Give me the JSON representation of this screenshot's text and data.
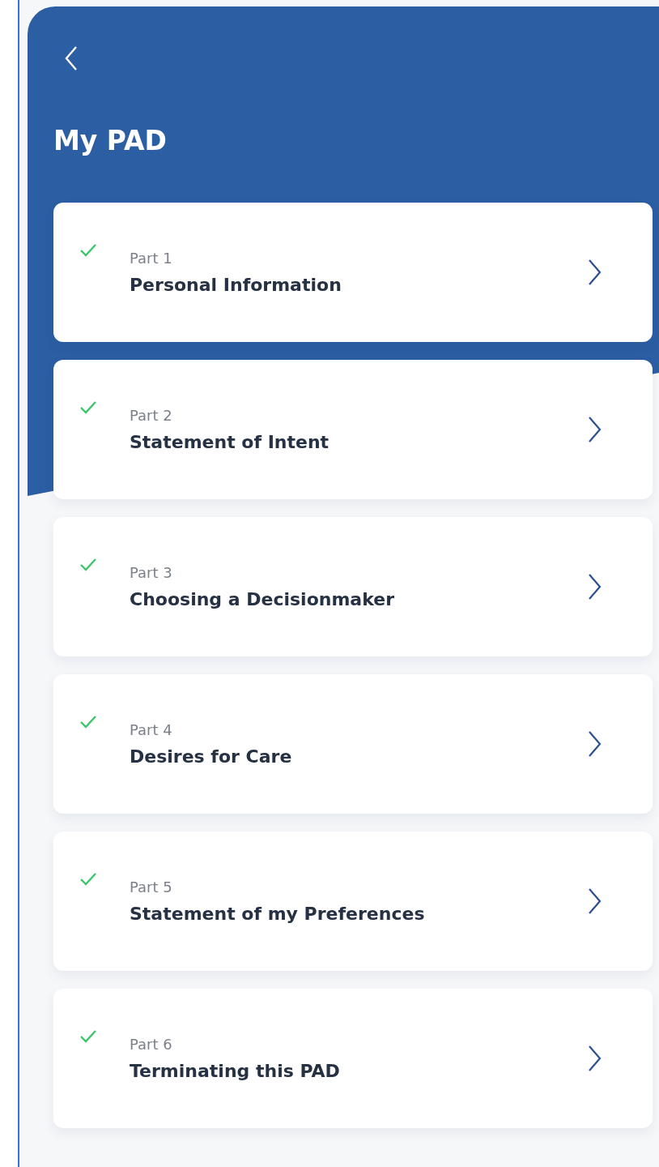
{
  "header": {
    "title": "My PAD"
  },
  "parts": [
    {
      "label": "Part 1",
      "title": "Personal Information",
      "completed": true
    },
    {
      "label": "Part 2",
      "title": "Statement of Intent",
      "completed": true
    },
    {
      "label": "Part 3",
      "title": "Choosing a Decisionmaker",
      "completed": true
    },
    {
      "label": "Part 4",
      "title": "Desires for Care",
      "completed": true
    },
    {
      "label": "Part 5",
      "title": "Statement of my Preferences",
      "completed": true
    },
    {
      "label": "Part 6",
      "title": "Terminating this PAD",
      "completed": true
    }
  ]
}
